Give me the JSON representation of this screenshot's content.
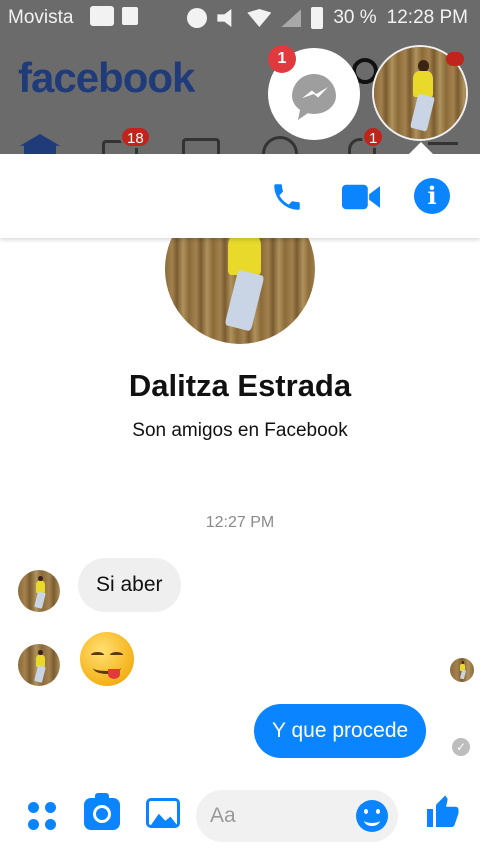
{
  "status_bar": {
    "carrier": "Movista",
    "battery": "30 %",
    "time": "12:28 PM"
  },
  "facebook": {
    "logo": "facebook",
    "watch_badge": "18",
    "notifications_badge": "1"
  },
  "chat_heads": {
    "messenger_badge": "1"
  },
  "conversation": {
    "contact_name": "Dalitza Estrada",
    "relationship": "Son amigos en Facebook",
    "timestamp": "12:27 PM",
    "messages": [
      {
        "from": "contact",
        "text": "Si aber"
      },
      {
        "from": "contact",
        "emoji": "face-savoring-food"
      },
      {
        "from": "me",
        "text": "Y que procede"
      }
    ]
  },
  "composer": {
    "placeholder": "Aa"
  },
  "colors": {
    "accent": "#0a84ff",
    "facebook_blue": "#1f3b7a",
    "badge_red": "#e0393e",
    "overlay_gray": "#6b6b6b"
  },
  "icons": [
    "phone-icon",
    "video-icon",
    "info-icon",
    "more-icon",
    "camera-icon",
    "gallery-icon",
    "emoji-icon",
    "like-icon",
    "messenger-icon"
  ]
}
